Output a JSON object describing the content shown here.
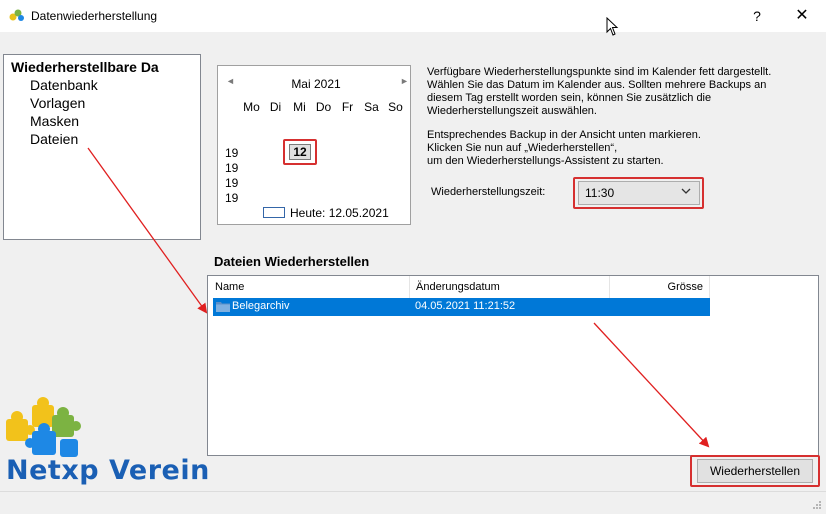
{
  "window": {
    "title": "Datenwiederherstellung",
    "help_label": "?",
    "close_label": "✕"
  },
  "tree": {
    "root_label": "Wiederherstellbare Da",
    "items": [
      {
        "label": "Datenbank"
      },
      {
        "label": "Vorlagen"
      },
      {
        "label": "Masken"
      },
      {
        "label": "Dateien"
      }
    ]
  },
  "calendar": {
    "month_label": "Mai 2021",
    "prev_icon": "chevron-left-icon",
    "next_icon": "chevron-right-icon",
    "weekdays": [
      "Mo",
      "Di",
      "Mi",
      "Do",
      "Fr",
      "Sa",
      "So"
    ],
    "week_numbers": [
      "19",
      "19",
      "19",
      "19"
    ],
    "highlighted_day": "12",
    "today_label": "Heute: 12.05.2021"
  },
  "info": {
    "line1": "Verfügbare Wiederherstellungspunkte sind im Kalender fett dargestellt.",
    "line2": "Wählen Sie das Datum im Kalender aus. Sollten mehrere Backups an",
    "line3": "diesem Tag erstellt worden sein, können Sie zusätzlich die",
    "line4": "Wiederherstellungszeit auswählen.",
    "line5": "Entsprechendes Backup in der Ansicht unten markieren.",
    "line6": "Klicken Sie nun auf „Wiederherstellen“,",
    "line7": "um den Wiederherstellungs-Assistent zu starten."
  },
  "restore_time": {
    "label": "Wiederherstellungszeit:",
    "value": "11:30"
  },
  "files_section": {
    "title": "Dateien Wiederherstellen",
    "columns": [
      "Name",
      "Änderungsdatum",
      "Grösse"
    ],
    "rows": [
      {
        "name": "Belegarchiv",
        "date": "04.05.2021 11:21:52",
        "size": "",
        "icon": "folder-icon",
        "selected": true
      }
    ]
  },
  "logo": {
    "text": "Netxp Verein"
  },
  "buttons": {
    "restore_label": "Wiederherstellen"
  },
  "colors": {
    "selection": "#0078d7",
    "annotation": "#d63030",
    "logo_text": "#1a5fb4"
  }
}
